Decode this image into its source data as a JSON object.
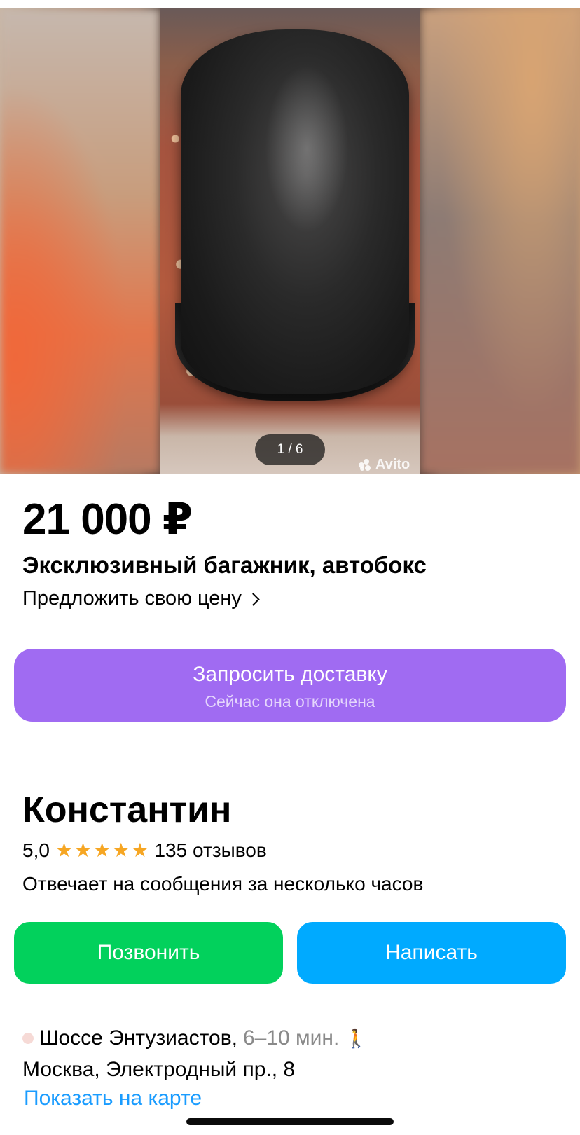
{
  "gallery": {
    "counter": "1 / 6",
    "watermark": "Avito"
  },
  "listing": {
    "price": "21 000 ₽",
    "title": "Эксклюзивный багажник, автобокс",
    "offer_price_label": "Предложить свою цену"
  },
  "delivery": {
    "label": "Запросить доставку",
    "sublabel": "Сейчас она отключена",
    "color": "#a06bf2"
  },
  "seller": {
    "name": "Константин",
    "rating": "5,0",
    "stars": 5,
    "reviews": "135 отзывов",
    "response": "Отвечает на сообщения за несколько часов"
  },
  "actions": {
    "call_label": "Позвонить",
    "call_color": "#02d15c",
    "message_label": "Написать",
    "message_color": "#00aaff"
  },
  "location": {
    "metro": "Шоссе Энтузиастов,",
    "metro_time": "6–10 мин.",
    "walk_icon": "walking-person-icon",
    "address": "Москва, Электродный пр., 8",
    "map_link": "Показать на карте"
  }
}
